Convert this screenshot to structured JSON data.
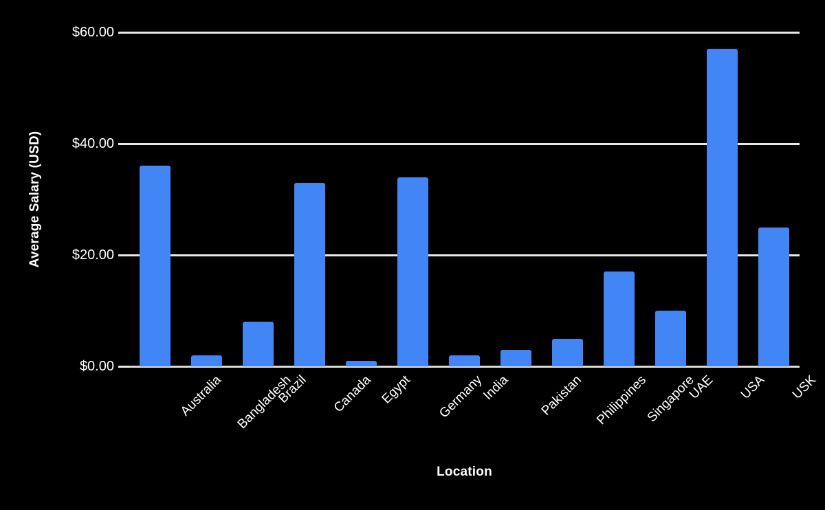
{
  "chart_data": {
    "type": "bar",
    "title": "",
    "xlabel": "Location",
    "ylabel": "Average Salary (USD)",
    "categories": [
      "Australia",
      "Bangladesh",
      "Brazil",
      "Canada",
      "Egypt",
      "Germany",
      "India",
      "Pakistan",
      "Philippines",
      "Singapore",
      "UAE",
      "USA",
      "USK"
    ],
    "values": [
      36,
      2,
      8,
      33,
      1,
      34,
      2,
      3,
      5,
      17,
      10,
      57,
      25
    ],
    "series": [
      {
        "name": "Average Salary (USD)",
        "values": [
          36,
          2,
          8,
          33,
          1,
          34,
          2,
          3,
          5,
          17,
          10,
          57,
          25
        ]
      }
    ],
    "ylim": [
      0,
      60
    ],
    "y_ticks": [
      0,
      20,
      40,
      60
    ],
    "y_tick_labels": [
      "$0.00",
      "$20.00",
      "$40.00",
      "$60.00"
    ],
    "grid": true,
    "legend": "none",
    "bar_color": "#4285f4",
    "background_color": "#000000",
    "text_color": "#ffffff",
    "gridline_color": "#e8e8e8"
  },
  "axes": {
    "y_title": "Average Salary (USD)",
    "x_title": "Location"
  }
}
